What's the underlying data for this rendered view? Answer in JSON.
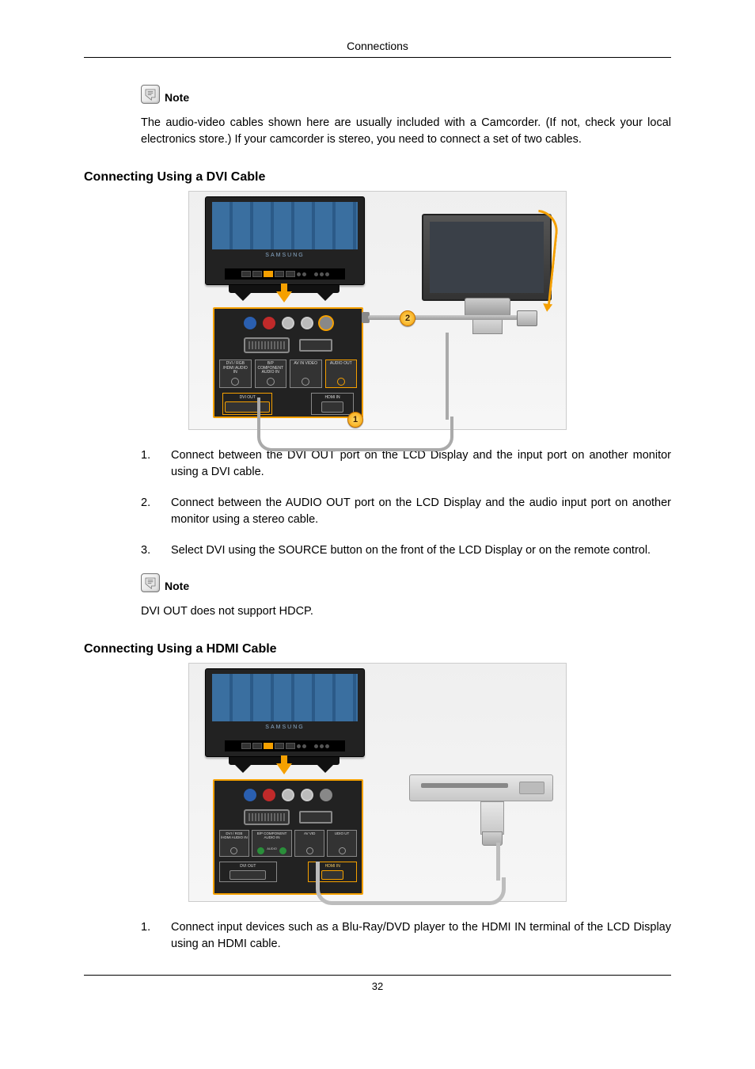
{
  "running_header": "Connections",
  "page_number": "32",
  "note_label": "Note",
  "note1_body": "The audio-video cables shown here are usually included with a Camcorder. (If not, check your local electronics store.) If your camcorder is stereo, you need to connect a set of two cables.",
  "section_dvi": {
    "title": "Connecting Using a DVI Cable",
    "steps": [
      "Connect between the DVI OUT port on the LCD Display and the input port on another monitor using a DVI cable.",
      "Connect between the AUDIO OUT port on the LCD Display and the audio input port on another monitor using a stereo cable.",
      "Select DVI using the SOURCE button on the front of the LCD Display or on the remote control."
    ],
    "note_body": "DVI OUT does not support HDCP.",
    "figure": {
      "brand": "SAMSUNG",
      "port_labels": {
        "dvi_hdmi_audio_in": "DVI / RGB\n/HDMI\nAUDIO IN",
        "component_audio_in": "B/P\nCOMPONENT\nAUDIO IN",
        "av_in_video": "AV IN\nVIDEO",
        "audio_out": "AUDIO\nOUT",
        "dvi_out": "DVI OUT",
        "hdmi_in": "HDMI IN"
      },
      "badges": {
        "one": "1",
        "two": "2"
      }
    }
  },
  "section_hdmi": {
    "title": "Connecting Using a HDMI Cable",
    "steps": [
      "Connect input devices such as a Blu-Ray/DVD player to the HDMI IN terminal of the LCD Display using an HDMI cable."
    ],
    "figure": {
      "brand": "SAMSUNG",
      "port_labels": {
        "dvi_hdmi_audio_in": "DVI / RGB\n/HDMI\nAUDIO IN",
        "component_audio_in": "B/P COMPONENT\nAUDIO IN",
        "audio": "AUDIO",
        "av_vid": "AV\nVID",
        "udio_ut": "UDIO\nUT",
        "dvi_out": "DVI OUT",
        "hdmi_in": "HDMI IN"
      }
    }
  }
}
